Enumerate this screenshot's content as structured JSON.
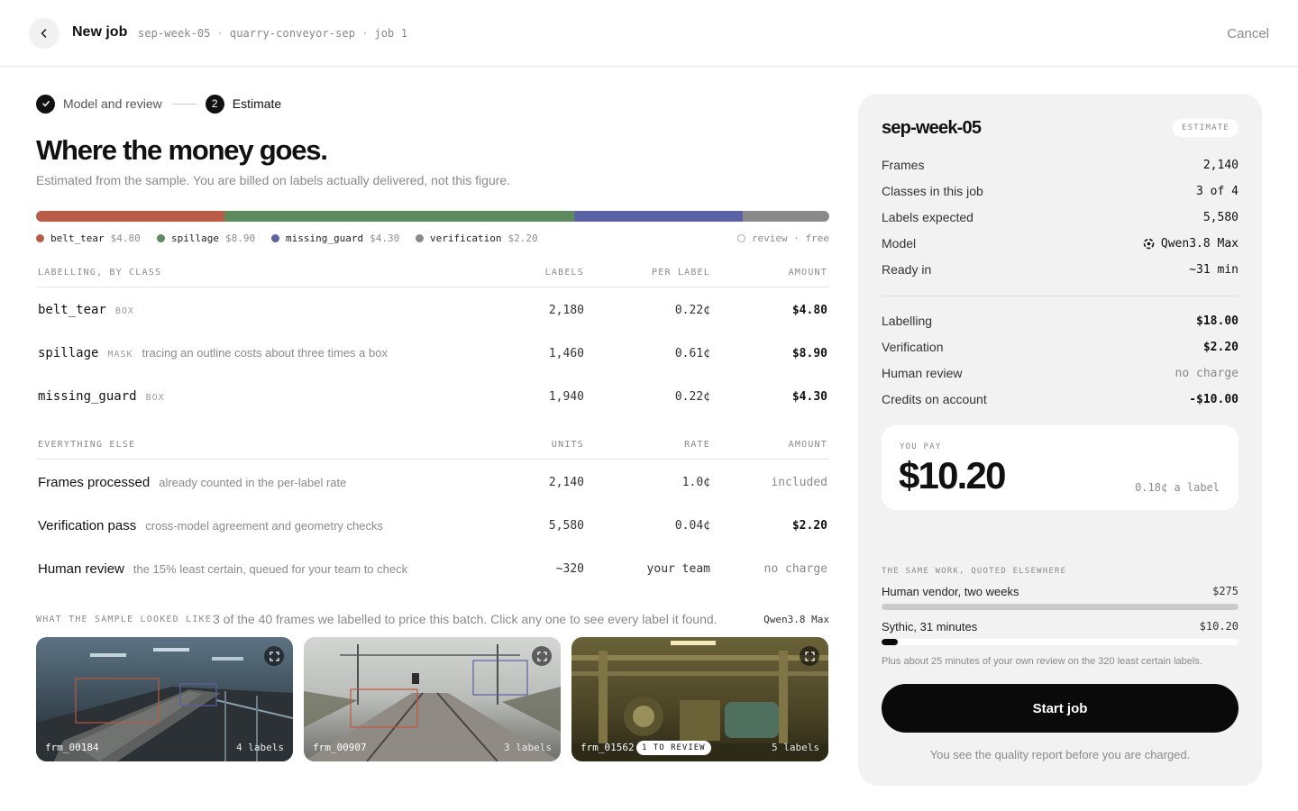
{
  "header": {
    "title": "New job",
    "breadcrumb": [
      "sep-week-05",
      "quarry-conveyor-sep",
      "job 1"
    ],
    "cancel_label": "Cancel"
  },
  "stepper": {
    "steps": [
      {
        "number": "1",
        "label": "Model and review",
        "state": "done"
      },
      {
        "number": "2",
        "label": "Estimate",
        "state": "current"
      }
    ]
  },
  "main": {
    "title": "Where the money goes.",
    "subtitle": "Estimated from the sample. You are billed on labels actually delivered, not this figure."
  },
  "cost_breakdown": {
    "segments": [
      {
        "name": "belt_tear",
        "amount": "$4.80",
        "value": 4.8,
        "color": "#b85c48"
      },
      {
        "name": "spillage",
        "amount": "$8.90",
        "value": 8.9,
        "color": "#5e8a5e"
      },
      {
        "name": "missing_guard",
        "amount": "$4.30",
        "value": 4.3,
        "color": "#5b62a3"
      },
      {
        "name": "verification",
        "amount": "$2.20",
        "value": 2.2,
        "color": "#8a8a8a"
      }
    ],
    "free_label": "review · free"
  },
  "labelling_table": {
    "headers": [
      "LABELLING, BY CLASS",
      "LABELS",
      "PER LABEL",
      "AMOUNT"
    ],
    "rows": [
      {
        "name": "belt_tear",
        "tag": "BOX",
        "note": "",
        "labels": "2,180",
        "per_label": "0.22¢",
        "amount": "$4.80"
      },
      {
        "name": "spillage",
        "tag": "MASK",
        "note": "tracing an outline costs about three times a box",
        "labels": "1,460",
        "per_label": "0.61¢",
        "amount": "$8.90"
      },
      {
        "name": "missing_guard",
        "tag": "BOX",
        "note": "",
        "labels": "1,940",
        "per_label": "0.22¢",
        "amount": "$4.30"
      }
    ]
  },
  "other_table": {
    "headers": [
      "EVERYTHING ELSE",
      "UNITS",
      "RATE",
      "AMOUNT"
    ],
    "rows": [
      {
        "name": "Frames processed",
        "note": "already counted in the per-label rate",
        "units": "2,140",
        "rate": "1.0¢",
        "amount": "included"
      },
      {
        "name": "Verification pass",
        "note": "cross-model agreement and geometry checks",
        "units": "5,580",
        "rate": "0.04¢",
        "amount": "$2.20"
      },
      {
        "name": "Human review",
        "note": "the 15% least certain, queued for your team to check",
        "units": "~320",
        "rate": "your team",
        "amount": "no charge"
      }
    ]
  },
  "sample": {
    "caption": "WHAT THE SAMPLE LOOKED LIKE",
    "description": "3 of the 40 frames we labelled to price this batch. Click any one to see every label it found.",
    "model": "Qwen3.8 Max",
    "frames": [
      {
        "id": "frm_00184",
        "labels": "4 labels",
        "badge": ""
      },
      {
        "id": "frm_00907",
        "labels": "3 labels",
        "badge": ""
      },
      {
        "id": "frm_01562",
        "labels": "5 labels",
        "badge": "1 TO REVIEW"
      }
    ]
  },
  "summary": {
    "title": "sep-week-05",
    "badge": "ESTIMATE",
    "details": [
      {
        "key": "Frames",
        "value": "2,140"
      },
      {
        "key": "Classes in this job",
        "value": "3 of 4"
      },
      {
        "key": "Labels expected",
        "value": "5,580"
      },
      {
        "key": "Model",
        "value": "Qwen3.8 Max",
        "icon": "model-logo-icon"
      },
      {
        "key": "Ready in",
        "value": "~31 min"
      }
    ],
    "costs": [
      {
        "key": "Labelling",
        "value": "$18.00"
      },
      {
        "key": "Verification",
        "value": "$2.20"
      },
      {
        "key": "Human review",
        "value": "no charge"
      },
      {
        "key": "Credits on account",
        "value": "-$10.00"
      }
    ],
    "pay": {
      "caption": "YOU PAY",
      "amount": "$10.20",
      "per_label": "0.18¢ a label"
    },
    "comparison": {
      "caption": "THE SAME WORK, QUOTED ELSEWHERE",
      "rows": [
        {
          "label": "Human vendor, two weeks",
          "value": "$275",
          "amount": 275,
          "color": "#c9c9c9"
        },
        {
          "label": "Sythic, 31 minutes",
          "value": "$10.20",
          "amount": 10.2,
          "color": "#0a0a0a"
        }
      ],
      "note": "Plus about 25 minutes of your own review on the 320 least certain labels."
    },
    "start_label": "Start job",
    "footnote": "You see the quality report before you are charged."
  }
}
